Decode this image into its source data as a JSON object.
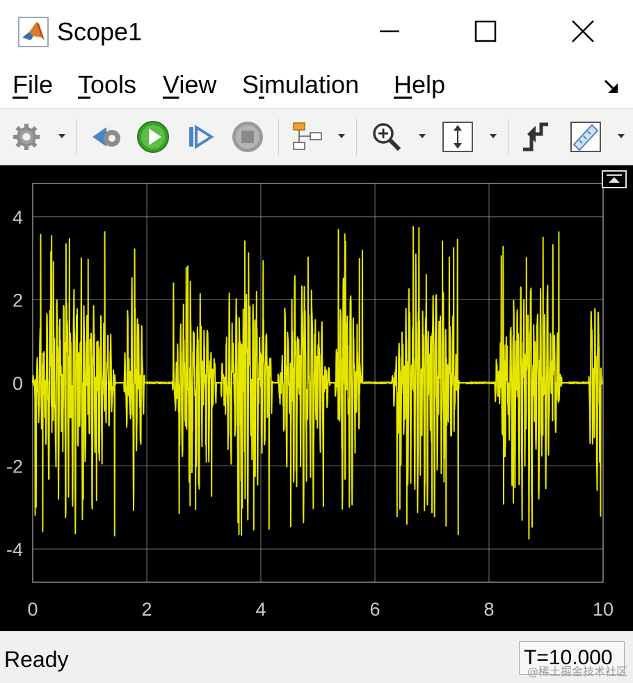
{
  "window": {
    "title": "Scope1",
    "controls": [
      "minimize-icon",
      "maximize-icon",
      "close-icon"
    ]
  },
  "menu": {
    "items": [
      {
        "mnemonic": "F",
        "rest": "ile"
      },
      {
        "mnemonic": "T",
        "rest": "ools"
      },
      {
        "mnemonic": "V",
        "rest": "iew"
      },
      {
        "pre": "S",
        "mnemonic": "i",
        "rest": "mulation"
      },
      {
        "mnemonic": "H",
        "rest": "elp"
      }
    ]
  },
  "toolbar": {
    "icons": [
      "gear-icon",
      "step-back-icon",
      "run-icon",
      "step-forward-icon",
      "stop-icon",
      "signal-selector-icon",
      "zoom-in-icon",
      "autoscale-icon",
      "trigger-icon",
      "measurements-icon"
    ]
  },
  "colors": {
    "plot_background": "#000000",
    "axes_background": "#000000",
    "grid": "#a6a6a6",
    "signal": "#e6e600",
    "tick_text": "#c8c8c8"
  },
  "chart_data": {
    "type": "line",
    "title": "",
    "xlabel": "",
    "ylabel": "",
    "xlim": [
      0,
      10
    ],
    "ylim": [
      -4.8,
      4.8
    ],
    "xticks": [
      "0",
      "2",
      "4",
      "6",
      "8",
      "10"
    ],
    "yticks": [
      "4",
      "2",
      "0",
      "-2",
      "-4"
    ],
    "grid": true,
    "legend": "none",
    "series": [
      {
        "color": "#e6e600",
        "bursts": [
          {
            "t_start": 0.0,
            "t_end": 1.6,
            "peak": 3.7
          },
          {
            "t_start": 1.6,
            "t_end": 2.0,
            "peak": 3.5
          },
          {
            "t_start": 2.45,
            "t_end": 3.3,
            "peak": 3.2
          },
          {
            "t_start": 3.3,
            "t_end": 4.3,
            "peak": 3.7
          },
          {
            "t_start": 4.3,
            "t_end": 5.3,
            "peak": 3.6
          },
          {
            "t_start": 5.3,
            "t_end": 5.8,
            "peak": 3.8
          },
          {
            "t_start": 6.3,
            "t_end": 7.6,
            "peak": 3.8
          },
          {
            "t_start": 8.1,
            "t_end": 9.4,
            "peak": 3.8
          },
          {
            "t_start": 9.75,
            "t_end": 10.0,
            "peak": 3.7
          }
        ]
      }
    ]
  },
  "status": {
    "text": "Ready",
    "time": "T=10.000"
  },
  "watermark": "@稀土掘金技术社区"
}
